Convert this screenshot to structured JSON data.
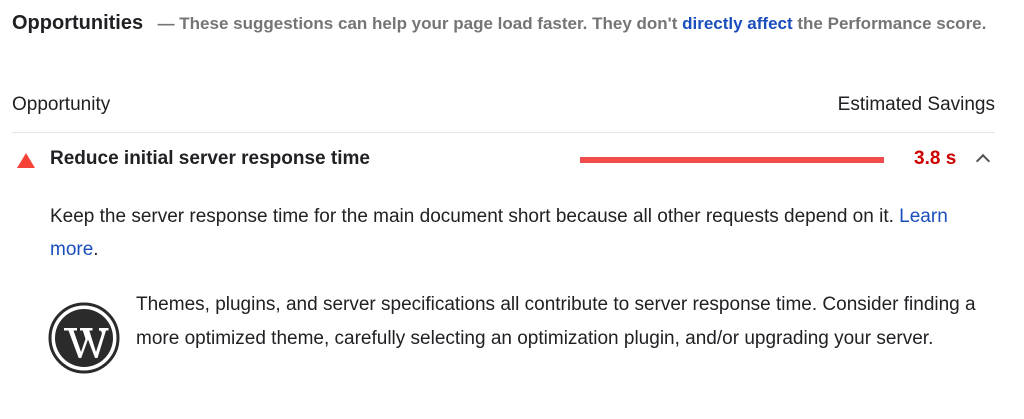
{
  "header": {
    "title": "Opportunities",
    "desc_prefix": "— These suggestions can help your page load faster. They don't",
    "desc_link": "directly affect",
    "desc_suffix": "the Performance score."
  },
  "table": {
    "col_opportunity": "Opportunity",
    "col_savings": "Estimated Savings"
  },
  "opportunity": {
    "title": "Reduce initial server response time",
    "savings_value": "3.8 s",
    "savings_fraction": 1.0,
    "status_color": "#f44336",
    "icon": "warning-triangle-icon",
    "expanded": true,
    "description_text": "Keep the server response time for the main document short because all other requests depend on it.",
    "learn_more": "Learn more",
    "description_end": "."
  },
  "stack_pack": {
    "icon": "wordpress-logo-icon",
    "text": "Themes, plugins, and server specifications all contribute to server response time. Consider finding a more optimized theme, carefully selecting an optimization plugin, and/or upgrading your server."
  },
  "colors": {
    "link": "#1a4ebc",
    "fail": "#cc0000",
    "bar": "#f24c4c"
  }
}
